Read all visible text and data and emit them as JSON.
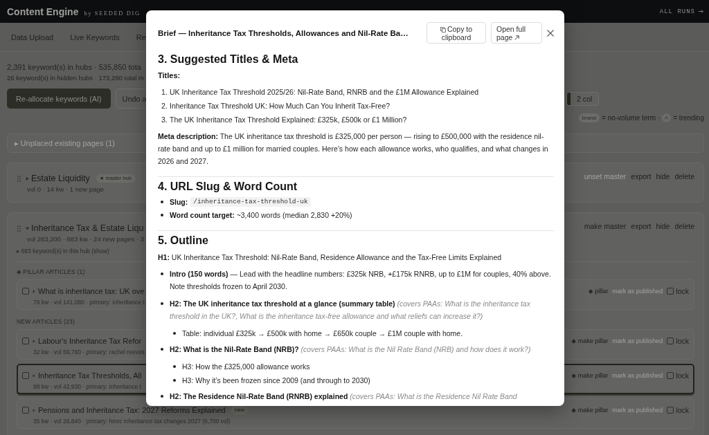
{
  "top_bar": {
    "brand": "Content Engine",
    "byline": "by SEEDED DIG",
    "runs_menu": "ALL RUNS"
  },
  "nav_tabs": [
    {
      "label": "Data Upload",
      "selected": false
    },
    {
      "label": "Live Keywords",
      "selected": false
    },
    {
      "label": "Re",
      "selected": false
    }
  ],
  "summary": {
    "hubs_line": "2,391 keyword(s) in hubs · 535,850 tota",
    "hidden_line": "26 keyword(s) in hidden hubs · 173,280 total m"
  },
  "toolbar_buttons": [
    {
      "label": "Re-allocate keywords (AI)",
      "kind": "primary"
    },
    {
      "label": "Undo a",
      "kind": "secondary"
    }
  ],
  "view_toggle": [
    {
      "selected": true
    },
    {
      "label": "2 col",
      "selected": false
    }
  ],
  "legend": [
    {
      "kind": "chip",
      "chip": "brand",
      "text": "= no-volume term ·"
    },
    {
      "kind": "icon",
      "text": "= trending"
    }
  ],
  "unplaced_pages": {
    "label": "▸ Unplaced existing pages (1)"
  },
  "hubs": [
    {
      "title": "Estate Liquidity",
      "expanded": false,
      "badge": "★ master hub",
      "stats": "vol 0 · 14 kw · 1 new page",
      "actions": [
        {
          "label": "unset master",
          "disabled": true
        },
        {
          "label": "export",
          "disabled": false
        },
        {
          "label": "hide",
          "disabled": false
        },
        {
          "label": "delete",
          "disabled": false
        }
      ]
    },
    {
      "title": "Inheritance Tax & Estate Liqu",
      "expanded": true,
      "stats": "vol 263,200 · 683 kw · 24 new pages · 3",
      "keywords_toggle": "▸ 683 keyword(s) in this hub (show)",
      "actions": [
        {
          "label": "make master",
          "disabled": false
        },
        {
          "label": "export",
          "disabled": false
        },
        {
          "label": "hide",
          "disabled": false
        },
        {
          "label": "delete",
          "disabled": false
        }
      ],
      "groups": [
        {
          "heading": "◈ PILLAR ARTICLES (1)",
          "articles": [
            {
              "title": "What is inheritance tax: UK ove",
              "meta": "78 kw · vol 141,080 · primary: inheritance t",
              "checked": false,
              "expanded": false,
              "selected": false,
              "pillar_action": "◈ pillar",
              "publish": "mark as published",
              "publish_disabled": true,
              "lock": "lock",
              "locked": false
            }
          ]
        },
        {
          "heading": "NEW ARTICLES (23)",
          "articles": [
            {
              "title": "Labour's Inheritance Tax Refor",
              "meta": "32 kw · vol 59,760 · primary: rachel reeves",
              "checked": false,
              "expanded": false,
              "selected": false,
              "pillar_action": "◈ make pillar",
              "publish": "mark as published",
              "publish_disabled": true,
              "lock": "lock",
              "locked": false
            },
            {
              "title": "Inheritance Tax Thresholds, All",
              "meta": "98 kw · vol 42,930 · primary: inheritance t",
              "checked": false,
              "expanded": false,
              "selected": true,
              "pillar_action": "◈ make pillar",
              "publish": "mark as published",
              "publish_disabled": true,
              "lock": "lock",
              "locked": false
            },
            {
              "title": "Pensions and Inheritance Tax: 2027 Reforms Explained",
              "badge": "new",
              "meta": "35 kw · vol 26,840 · primary: hmrc inheritance tax changes 2027 (6,700 vol)",
              "checked": false,
              "expanded": false,
              "selected": false,
              "pillar_action": "◈ make pillar",
              "publish": "mark as published",
              "publish_disabled": true,
              "lock": "lock",
              "locked": false
            }
          ]
        }
      ]
    }
  ],
  "brief_modal": {
    "title": "Brief — Inheritance Tax Thresholds, Allowances and Nil-Rate Ba…",
    "buttons": [
      {
        "label": "Copy to clipboard",
        "kind": "copy"
      },
      {
        "label": "Open full page",
        "kind": "open"
      }
    ],
    "sections": [
      {
        "heading": "3. Suggested Titles & Meta",
        "blocks": [
          {
            "kind": "label",
            "text": "Titles:"
          },
          {
            "kind": "numbered",
            "items": [
              {
                "marker": "1.",
                "text": "UK Inheritance Tax Threshold 2025/26: Nil-Rate Band, RNRB and the £1M Allowance Explained"
              },
              {
                "marker": "2.",
                "text": "Inheritance Tax Threshold UK: How Much Can You Inherit Tax-Free?"
              },
              {
                "marker": "3.",
                "text": "The UK Inheritance Tax Threshold Explained: £325k, £500k or £1 Million?"
              }
            ]
          },
          {
            "kind": "paragraph",
            "text": "**Meta description:** The UK inheritance tax threshold is £325,000 per person — rising to £500,000 with the residence nil-rate band and up to £1 million for married couples. Here’s how each allowance works, who qualifies, and what changes in 2026 and 2027."
          }
        ]
      },
      {
        "heading": "4. URL Slug & Word Count",
        "blocks": [
          {
            "kind": "bullets",
            "items": [
              {
                "kind": "code",
                "label": "Slug:",
                "code": "/inheritance-tax-threshold-uk"
              },
              {
                "kind": "text",
                "text": "**Word count target:** ~3,400 words (median 2,830 +20%)"
              }
            ]
          }
        ]
      },
      {
        "heading": "5. Outline",
        "blocks": [
          {
            "kind": "paragraph",
            "text": "**H1:** UK Inheritance Tax Threshold: Nil-Rate Band, Residence Allowance and the Tax-Free Limits Explained"
          },
          {
            "kind": "bullets",
            "items": [
              {
                "kind": "text",
                "text": "**Intro (150 words)** — Lead with the headline numbers: £325k NRB, +£175k RNRB, up to £1M for couples, 40% above. Note thresholds frozen to April 2030."
              },
              {
                "kind": "text",
                "text": "**H2: The UK inheritance tax threshold at a glance (summary table)** *(covers PAAs: What is the inheritance tax threshold in the UK?, What is the inheritance tax-free allowance and what reliefs can increase it?)*",
                "children": [
                  {
                    "text": "Table: individual £325k → £500k with home → £650k couple → £1M couple with home."
                  }
                ]
              },
              {
                "kind": "text",
                "text": "**H2: What is the Nil-Rate Band (NRB)?** *(covers PAAs: What is the Nil Rate Band (NRB) and how does it work?)*",
                "children": [
                  {
                    "text": "H3: How the £325,000 allowance works"
                  },
                  {
                    "text": "H3: Why it’s been frozen since 2009 (and through to 2030)"
                  }
                ]
              },
              {
                "kind": "text",
                "text": "**H2: The Residence Nil-Rate Band (RNRB) explained** *(covers PAAs: What is the Residence Nil Rate Band*"
              }
            ]
          }
        ]
      }
    ]
  }
}
